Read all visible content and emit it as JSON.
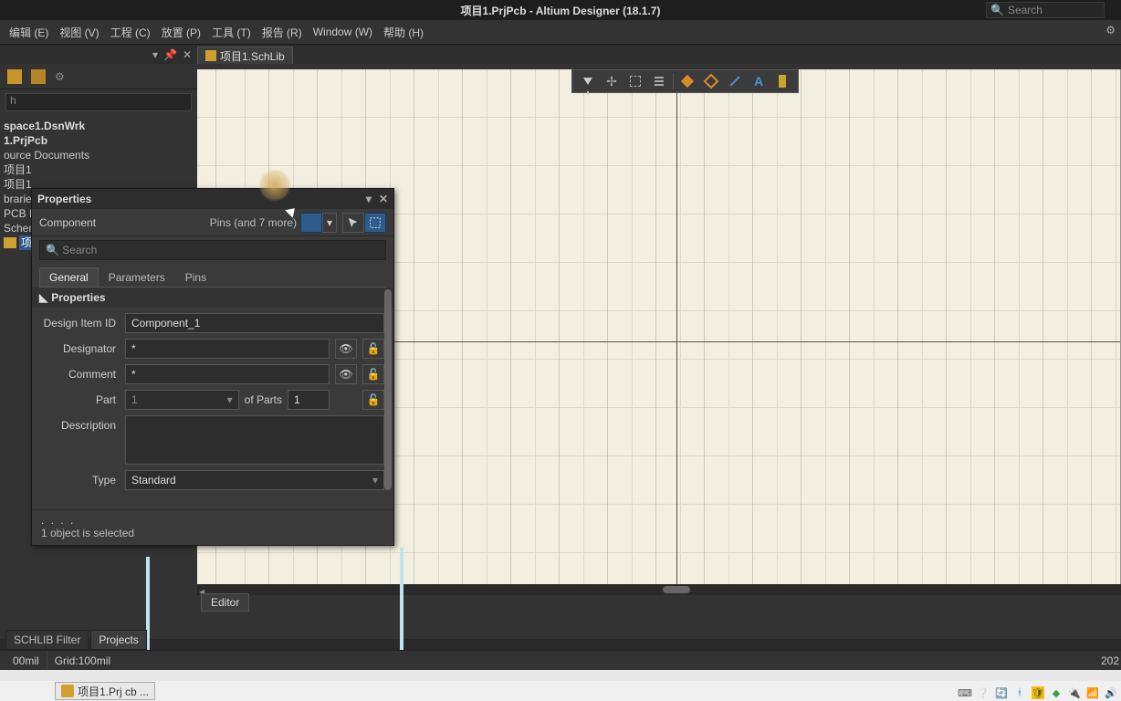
{
  "app": {
    "title": "项目1.PrjPcb - Altium Designer (18.1.7)",
    "search_placeholder": "Search"
  },
  "menu": {
    "items": [
      "编辑 (E)",
      "视图 (V)",
      "工程 (C)",
      "放置 (P)",
      "工具 (T)",
      "报告 (R)",
      "Window (W)",
      "帮助 (H)"
    ]
  },
  "doc_tab": {
    "label": "项目1.SchLib"
  },
  "left_panel": {
    "search_placeholder": "h",
    "tree": {
      "workspace": "space1.DsnWrk",
      "project": "1.PrjPcb",
      "source_docs": "ource Documents",
      "doc1": "项目1",
      "doc2": "项目1",
      "libraries": "braries",
      "pcbl": "PCB L",
      "schem": "Schem",
      "sel_item": "项目"
    }
  },
  "floating_toolbar": {
    "icons": [
      "filter-icon",
      "move-icon",
      "select-rect-icon",
      "align-icon",
      "place-part-icon",
      "polygon-fill-icon",
      "polygon-outline-icon",
      "line-icon",
      "text-icon",
      "bus-icon"
    ]
  },
  "properties_panel": {
    "title": "Properties",
    "object_type": "Component",
    "filter_text": "Pins (and 7 more)",
    "search_placeholder": "Search",
    "tabs": [
      "General",
      "Parameters",
      "Pins"
    ],
    "active_tab": "General",
    "section": "Properties",
    "fields": {
      "design_item_id_label": "Design Item ID",
      "design_item_id_value": "Component_1",
      "designator_label": "Designator",
      "designator_value": "*",
      "comment_label": "Comment",
      "comment_value": "*",
      "part_label": "Part",
      "part_value": "1",
      "of_parts_label": "of Parts",
      "of_parts_value": "1",
      "description_label": "Description",
      "description_value": "",
      "type_label": "Type",
      "type_value": "Standard"
    },
    "footer": "1 object is selected"
  },
  "bottom_panel_tabs": [
    "SCHLIB Filter",
    "Projects"
  ],
  "editor_tab": "Editor",
  "status": {
    "pos": "00mil",
    "grid": "Grid:100mil",
    "right_num": "202"
  },
  "taskbar": {
    "item": "项目1.Prj cb ..."
  }
}
